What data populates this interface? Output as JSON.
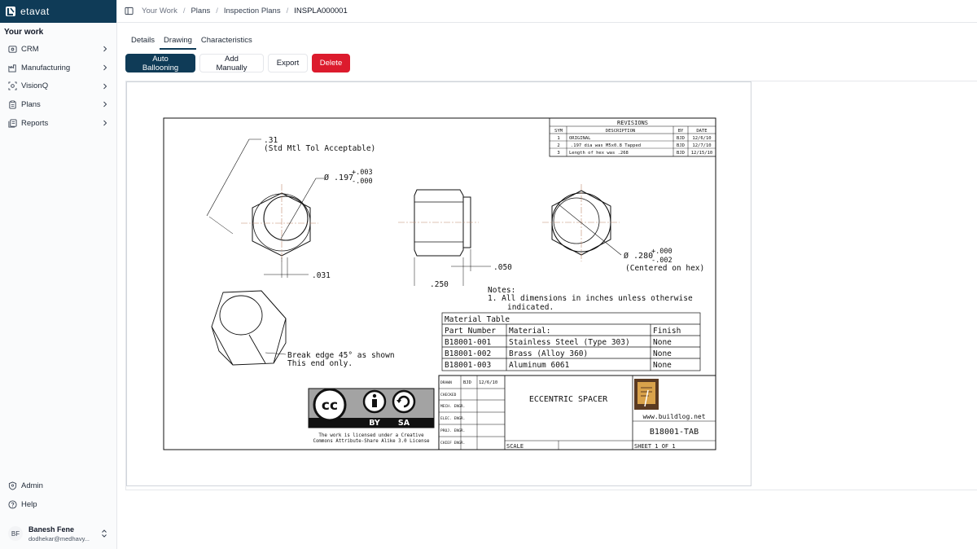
{
  "brand": {
    "name": "etavat"
  },
  "sidebar": {
    "section": "Your work",
    "items": [
      {
        "label": "CRM",
        "icon": "crm-icon"
      },
      {
        "label": "Manufacturing",
        "icon": "factory-icon"
      },
      {
        "label": "VisionQ",
        "icon": "vision-icon"
      },
      {
        "label": "Plans",
        "icon": "clipboard-icon"
      },
      {
        "label": "Reports",
        "icon": "reports-icon"
      }
    ],
    "bottom": [
      {
        "label": "Admin",
        "icon": "admin-icon"
      },
      {
        "label": "Help",
        "icon": "help-icon"
      }
    ],
    "user": {
      "initials": "BF",
      "name": "Banesh Fene",
      "email": "dodhekar@medhavy..."
    }
  },
  "breadcrumb": [
    "Your Work",
    "Plans",
    "Inspection Plans",
    "INSPLA000001"
  ],
  "tabs": [
    "Details",
    "Drawing",
    "Characteristics"
  ],
  "active_tab": "Drawing",
  "actions": {
    "auto_ballooning": "Auto Ballooning",
    "add_manually": "Add Manually",
    "export": "Export",
    "delete": "Delete"
  },
  "drawing": {
    "revisions": {
      "title": "REVISIONS",
      "headers": [
        "SYM",
        "DESCRIPTION",
        "BY",
        "DATE"
      ],
      "rows": [
        [
          "1",
          "ORIGINAL",
          "BJD",
          "12/6/10"
        ],
        [
          "2",
          ".197 dia was M5x0.8 Tapped",
          "BJD",
          "12/7/10"
        ],
        [
          "3",
          "Length of hex was .268",
          "BJD",
          "12/15/10"
        ]
      ]
    },
    "dims": {
      "d31": ".31",
      "std_tol": "(Std Mtl Tol Acceptable)",
      "dia197": "Ø .197",
      "tol197_plus": "+.003",
      "tol197_minus": "-.000",
      "d031": ".031",
      "d250": ".250",
      "d050": ".050",
      "dia280": "Ø .280",
      "tol280_plus": "+.000",
      "tol280_minus": "-.002",
      "centered": "(Centered on hex)"
    },
    "notes": {
      "title": "Notes:",
      "line1": "1.  All dimensions in inches unless otherwise",
      "line2": "indicated."
    },
    "break_edge": {
      "line1": "Break edge 45° as shown",
      "line2": "This end only."
    },
    "material_table": {
      "title": "Material Table",
      "headers": [
        "Part Number",
        "Material:",
        "Finish"
      ],
      "rows": [
        [
          "B18001-001",
          "Stainless Steel (Type 303)",
          "None"
        ],
        [
          "B18001-002",
          "Brass (Alloy 360)",
          "None"
        ],
        [
          "B18001-003",
          "Aluminum 6061",
          "None"
        ]
      ]
    },
    "license": {
      "cc": "cc",
      "by": "BY",
      "sa": "SA",
      "line1": "The work is licensed under a Creative",
      "line2": "Commons Attribute-Share Alike 3.0 License"
    },
    "title_block": {
      "rows": [
        {
          "label": "DRAWN",
          "by": "BJD",
          "date": "12/6/10"
        },
        {
          "label": "CHECKED",
          "by": "",
          "date": ""
        },
        {
          "label": "MECH. ENGR.",
          "by": "",
          "date": ""
        },
        {
          "label": "ELEC. ENGR.",
          "by": "",
          "date": ""
        },
        {
          "label": "PROJ. ENGR.",
          "by": "",
          "date": ""
        },
        {
          "label": "CHIEF ENGR.",
          "by": "",
          "date": ""
        }
      ],
      "title": "ECCENTRIC SPACER",
      "website": "www.buildlog.net",
      "part_number": "B18001-TAB",
      "scale": "SCALE",
      "sheet": "SHEET 1 OF 1"
    }
  }
}
